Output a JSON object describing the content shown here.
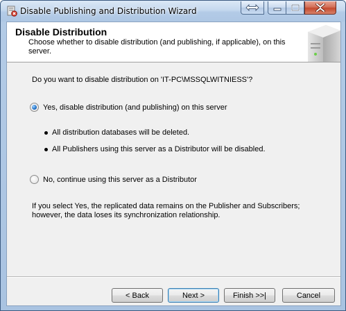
{
  "window": {
    "title": "Disable Publishing and Distribution Wizard"
  },
  "header": {
    "title": "Disable Distribution",
    "description": "Choose whether to disable distribution (and publishing, if applicable), on this server."
  },
  "body": {
    "question": "Do you want to disable distribution on 'IT-PC\\MSSQLWITNIESS'?",
    "options": [
      {
        "label": "Yes, disable distribution (and publishing) on this server",
        "selected": true
      },
      {
        "label": "No, continue using this server as a Distributor",
        "selected": false
      }
    ],
    "bullets": [
      "All distribution databases will be deleted.",
      "All Publishers using this server as a Distributor will be disabled."
    ],
    "note": "If you select Yes, the replicated data remains on the Publisher and Subscribers; however, the data loses its synchronization relationship."
  },
  "buttons": {
    "back": "< Back",
    "next": "Next >",
    "finish": "Finish >>|",
    "cancel": "Cancel"
  },
  "icons": {
    "app": "wizard-app-icon",
    "header_graphic": "server-icon",
    "restore": "restore-arrows-icon",
    "minimize": "minimize-icon",
    "maximize": "maximize-icon",
    "close": "close-icon"
  },
  "colors": {
    "radio_selected": "#1f6fc6",
    "close_button": "#c44a2f",
    "default_button_border": "#3c7fb1"
  }
}
